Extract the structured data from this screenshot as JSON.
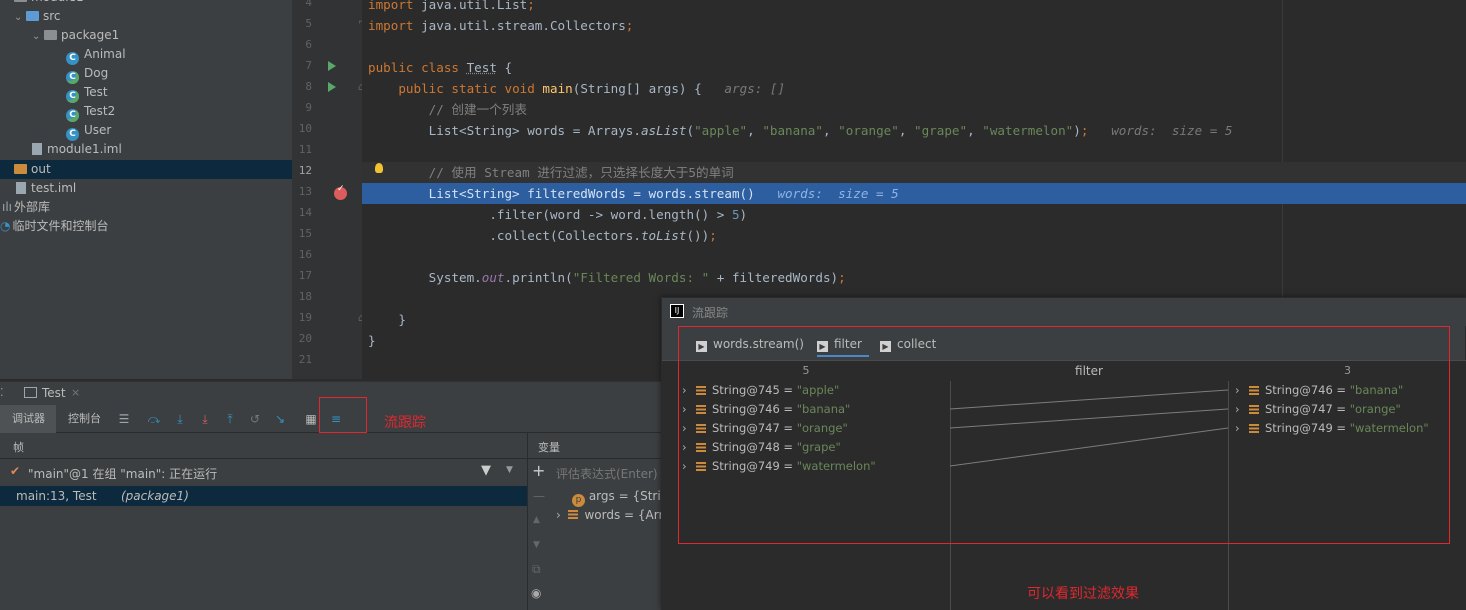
{
  "project_tree": {
    "items": [
      {
        "label": "src",
        "icon": "folder-icon"
      },
      {
        "label": "package1",
        "icon": "package-icon"
      },
      {
        "label": "Animal",
        "icon": "class-icon"
      },
      {
        "label": "Dog",
        "icon": "class-icon"
      },
      {
        "label": "Test",
        "icon": "class-icon"
      },
      {
        "label": "Test2",
        "icon": "class-icon"
      },
      {
        "label": "User",
        "icon": "class-icon"
      },
      {
        "label": "module1.iml",
        "icon": "iml-file-icon"
      },
      {
        "label": "out",
        "icon": "folder-icon"
      },
      {
        "label": "test.iml",
        "icon": "iml-file-icon"
      },
      {
        "label": "外部库",
        "icon": "library-icon"
      },
      {
        "label": "临时文件和控制台",
        "icon": "scratch-icon"
      }
    ]
  },
  "editor": {
    "line_numbers": [
      "4",
      "5",
      "6",
      "7",
      "8",
      "9",
      "10",
      "11",
      "12",
      "13",
      "14",
      "15",
      "16",
      "17",
      "18",
      "19",
      "20",
      "21"
    ],
    "hints": {
      "args": "args: []",
      "words": "words:  size = 5",
      "exec_words": "words:  size = 5"
    }
  },
  "debug": {
    "run_tab": "Test",
    "tabs": {
      "debugger": "调试器",
      "console": "控制台"
    },
    "frames_header": "帧",
    "thread": "\"main\"@1 在组 \"main\": 正在运行",
    "frame": "main:13, Test",
    "frame_pkg": "(package1)",
    "vars_header": "变量",
    "eval_placeholder": "评估表达式(Enter)",
    "vars": [
      {
        "name": "args",
        "value": "= {Strin"
      },
      {
        "name": "words",
        "value": "= {Arr"
      }
    ],
    "annotation": "流跟踪"
  },
  "trace": {
    "title": "流跟踪",
    "tabs": [
      "words.stream()",
      "filter",
      "collect"
    ],
    "left_count": "5",
    "middle_label": "filter",
    "right_count": "3",
    "left_items": [
      {
        "name": "String@745",
        "value": "\"apple\""
      },
      {
        "name": "String@746",
        "value": "\"banana\""
      },
      {
        "name": "String@747",
        "value": "\"orange\""
      },
      {
        "name": "String@748",
        "value": "\"grape\""
      },
      {
        "name": "String@749",
        "value": "\"watermelon\""
      }
    ],
    "right_items": [
      {
        "name": "String@746",
        "value": "\"banana\""
      },
      {
        "name": "String@747",
        "value": "\"orange\""
      },
      {
        "name": "String@749",
        "value": "\"watermelon\""
      }
    ],
    "annotation": "可以看到过滤效果"
  },
  "colors": {
    "accent": "#4a88c7",
    "annotation_red": "#e0282e",
    "exec_line": "#2d5fa0"
  }
}
